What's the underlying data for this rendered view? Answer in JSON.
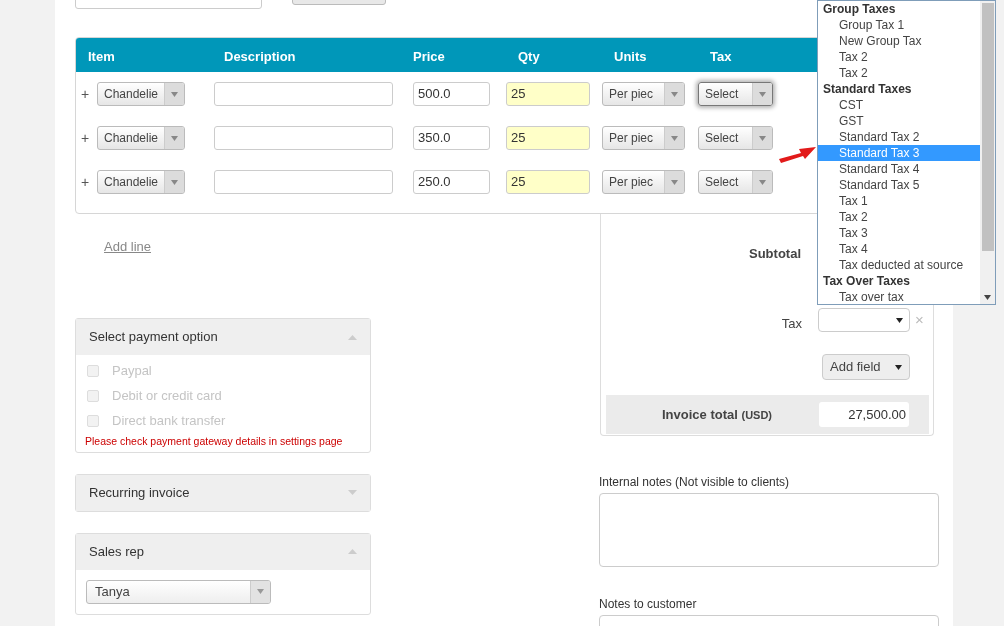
{
  "line_items": {
    "columns": [
      "Item",
      "Description",
      "Price",
      "Qty",
      "Units",
      "Tax"
    ],
    "rows": [
      {
        "add": "+",
        "item": "Chandelie",
        "price": "500.0",
        "qty": "25",
        "units": "Per piec",
        "tax": "Select",
        "focused": true
      },
      {
        "add": "+",
        "item": "Chandelie",
        "price": "350.0",
        "qty": "25",
        "units": "Per piec",
        "tax": "Select",
        "focused": false
      },
      {
        "add": "+",
        "item": "Chandelie",
        "price": "250.0",
        "qty": "25",
        "units": "Per piec",
        "tax": "Select",
        "focused": false
      }
    ]
  },
  "add_line": "Add line",
  "payment_panel": {
    "title": "Select payment option",
    "expanded": true,
    "options": [
      {
        "label": "Paypal",
        "checked": false,
        "disabled": true
      },
      {
        "label": "Debit or credit card",
        "checked": false,
        "disabled": true
      },
      {
        "label": "Direct bank transfer",
        "checked": false,
        "disabled": true
      }
    ],
    "warning": "Please check payment gateway details in settings page"
  },
  "recurring_panel": {
    "title": "Recurring invoice",
    "expanded": false
  },
  "sales_rep_panel": {
    "title": "Sales rep",
    "expanded": true,
    "value": "Tanya"
  },
  "totals": {
    "subtotal_label": "Subtotal",
    "tax_label": "Tax",
    "clear": "×",
    "add_field": "Add field",
    "invoice_total_label": "Invoice total",
    "currency": "(USD)",
    "invoice_total": "27,500.00"
  },
  "notes": [
    {
      "label": "Internal notes (Not visible to clients)"
    },
    {
      "label": "Notes to customer"
    }
  ],
  "tax_dropdown": {
    "groups": [
      {
        "label": "Group Taxes",
        "options": [
          {
            "label": "Group Tax 1",
            "selected": false
          },
          {
            "label": "New Group Tax",
            "selected": false
          },
          {
            "label": "Tax 2",
            "selected": false
          },
          {
            "label": "Tax 2",
            "selected": false
          }
        ]
      },
      {
        "label": "Standard Taxes",
        "options": [
          {
            "label": "CST",
            "selected": false
          },
          {
            "label": "GST",
            "selected": false
          },
          {
            "label": "Standard Tax 2",
            "selected": false
          },
          {
            "label": "Standard Tax 3",
            "selected": true
          },
          {
            "label": "Standard Tax 4",
            "selected": false
          },
          {
            "label": "Standard Tax 5",
            "selected": false
          },
          {
            "label": "Tax 1",
            "selected": false
          },
          {
            "label": "Tax 2",
            "selected": false
          },
          {
            "label": "Tax 3",
            "selected": false
          },
          {
            "label": "Tax 4",
            "selected": false
          },
          {
            "label": "Tax deducted at source",
            "selected": false
          }
        ]
      },
      {
        "label": "Tax Over Taxes",
        "options": [
          {
            "label": "Tax over tax",
            "selected": false
          }
        ]
      }
    ]
  }
}
